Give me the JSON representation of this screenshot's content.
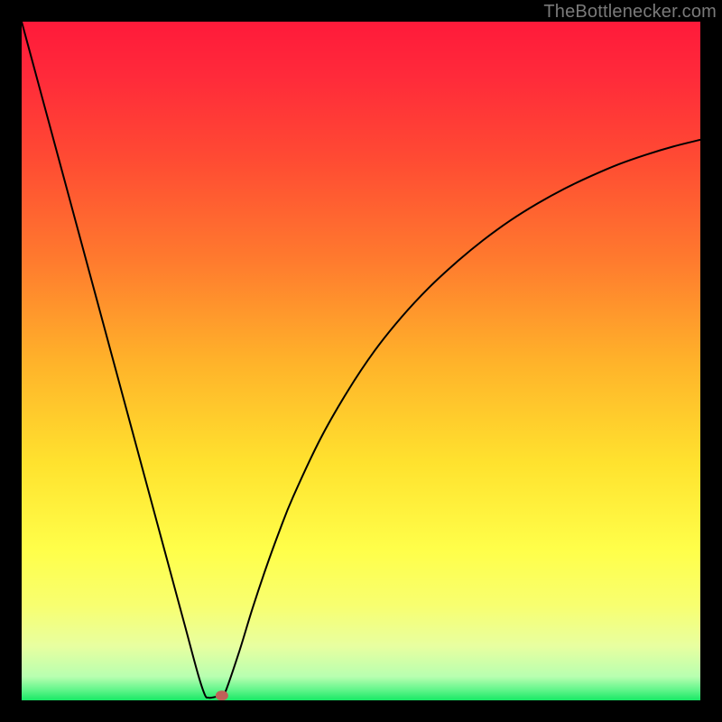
{
  "credit": "TheBottlenecker.com",
  "chart_data": {
    "type": "line",
    "title": "",
    "xlabel": "",
    "ylabel": "",
    "xlim": [
      0,
      100
    ],
    "ylim": [
      0,
      100
    ],
    "series": [
      {
        "name": "bottleneck-curve",
        "x": [
          0,
          2,
          4,
          6,
          8,
          10,
          12,
          14,
          16,
          18,
          20,
          22,
          24,
          26,
          27,
          27.5,
          28,
          29,
          29.5,
          30,
          32,
          34,
          36,
          38,
          40,
          44,
          48,
          52,
          56,
          60,
          64,
          68,
          72,
          76,
          80,
          84,
          88,
          92,
          96,
          100
        ],
        "y": [
          100,
          92.6,
          85.2,
          77.8,
          70.4,
          63.0,
          55.6,
          48.2,
          40.8,
          33.4,
          26.0,
          18.6,
          11.2,
          3.8,
          0.8,
          0.4,
          0.4,
          0.6,
          0.7,
          1.2,
          7.0,
          13.5,
          19.5,
          25.0,
          30.0,
          38.5,
          45.5,
          51.5,
          56.5,
          60.8,
          64.5,
          67.8,
          70.7,
          73.2,
          75.4,
          77.3,
          79.0,
          80.4,
          81.6,
          82.6
        ]
      }
    ],
    "marker": {
      "x_pct": 29.5,
      "y_pct": 0.7
    },
    "gradient_stops": [
      {
        "offset": 0.0,
        "color": "#ff1a3a"
      },
      {
        "offset": 0.08,
        "color": "#ff2a3a"
      },
      {
        "offset": 0.2,
        "color": "#ff4a33"
      },
      {
        "offset": 0.35,
        "color": "#ff7a2e"
      },
      {
        "offset": 0.5,
        "color": "#ffb22a"
      },
      {
        "offset": 0.65,
        "color": "#ffe22e"
      },
      {
        "offset": 0.78,
        "color": "#ffff4a"
      },
      {
        "offset": 0.86,
        "color": "#f8ff70"
      },
      {
        "offset": 0.92,
        "color": "#e8ffa0"
      },
      {
        "offset": 0.965,
        "color": "#b8ffb0"
      },
      {
        "offset": 0.985,
        "color": "#60f58a"
      },
      {
        "offset": 1.0,
        "color": "#18e865"
      }
    ]
  }
}
